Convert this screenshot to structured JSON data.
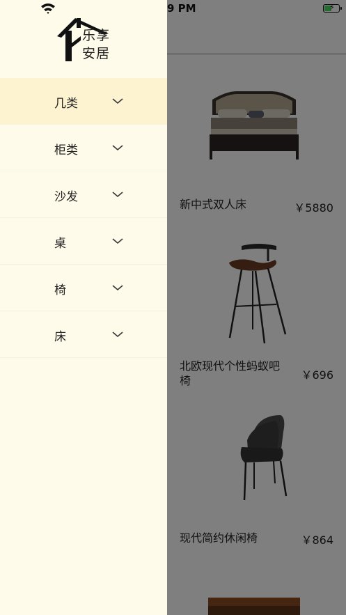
{
  "status_bar": {
    "time": "9 PM"
  },
  "app": {
    "logo_line1": "乐享",
    "logo_line2": "安居"
  },
  "drawer_menu": [
    {
      "label": "几类",
      "active": true
    },
    {
      "label": "柜类",
      "active": false
    },
    {
      "label": "沙发",
      "active": false
    },
    {
      "label": "桌",
      "active": false
    },
    {
      "label": "椅",
      "active": false
    },
    {
      "label": "床",
      "active": false
    }
  ],
  "products": [
    {
      "name": "新中式双人床",
      "price": "￥5880",
      "image": "bed"
    },
    {
      "name": "北欧现代个性蚂蚁吧椅",
      "price": "￥696",
      "image": "bar-stool"
    },
    {
      "name": "现代简约休闲椅",
      "price": "￥864",
      "image": "lounge-chair"
    }
  ],
  "colors": {
    "drawer_bg": "#fefbea",
    "active_item_bg": "#fdf3d0",
    "overlay": "rgba(0,0,0,0.5)"
  }
}
